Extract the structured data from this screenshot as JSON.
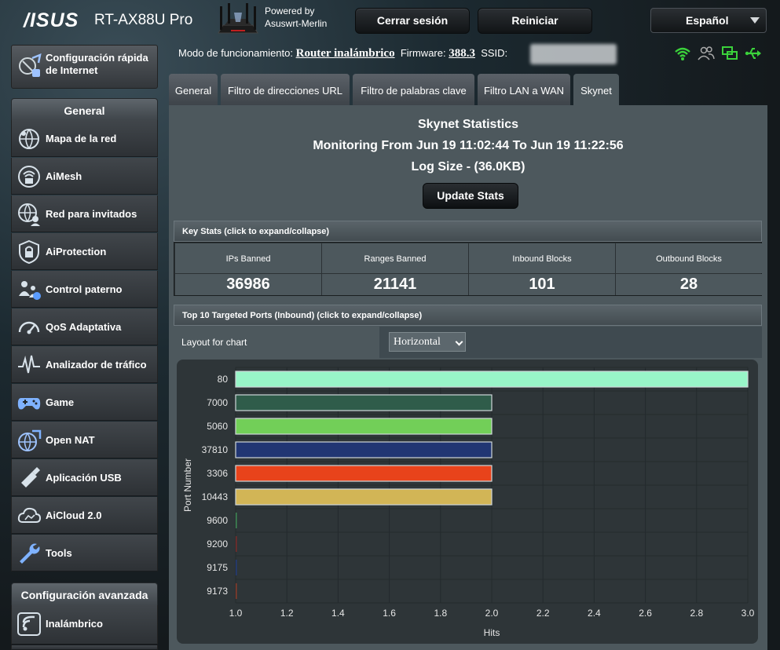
{
  "header": {
    "brand": "/ISUS",
    "model": "RT-AX88U Pro",
    "powered_line1": "Powered by",
    "powered_line2": "Asuswrt-Merlin",
    "logout_label": "Cerrar sesión",
    "reboot_label": "Reiniciar",
    "language": "Español"
  },
  "sidebar": {
    "quick_setup": "Configuración rápida de Internet",
    "general_title": "General",
    "items": [
      {
        "label": "Mapa de la red",
        "icon": "network-map-icon"
      },
      {
        "label": "AiMesh",
        "icon": "aimesh-icon"
      },
      {
        "label": "Red para invitados",
        "icon": "guest-network-icon"
      },
      {
        "label": "AiProtection",
        "icon": "shield-lock-icon"
      },
      {
        "label": "Control paterno",
        "icon": "parental-control-icon"
      },
      {
        "label": "QoS Adaptativa",
        "icon": "speedometer-icon"
      },
      {
        "label": "Analizador de tráfico",
        "icon": "traffic-analyzer-icon"
      },
      {
        "label": "Game",
        "icon": "gamepad-icon"
      },
      {
        "label": "Open NAT",
        "icon": "open-nat-icon"
      },
      {
        "label": "Aplicación USB",
        "icon": "usb-app-icon"
      },
      {
        "label": "AiCloud 2.0",
        "icon": "cloud-icon"
      },
      {
        "label": "Tools",
        "icon": "wrench-icon"
      }
    ],
    "advanced_title": "Configuración avanzada",
    "advanced_items": [
      {
        "label": "Inalámbrico",
        "icon": "wireless-icon"
      }
    ]
  },
  "status": {
    "mode_label": "Modo de funcionamiento:",
    "mode_value": "Router inalámbrico",
    "firmware_label": "Firmware:",
    "firmware_value": "388.3",
    "ssid_label": "SSID:"
  },
  "tabs": [
    "General",
    "Filtro de direcciones URL",
    "Filtro de palabras clave",
    "Filtro LAN a WAN",
    "Skynet"
  ],
  "skynet": {
    "title": "Skynet Statistics",
    "monitoring": "Monitoring From Jun 19 11:02:44 To Jun 19 11:22:56",
    "log_size": "Log Size - (36.0KB)",
    "update_button": "Update Stats",
    "key_stats_header": "Key Stats (click to expand/collapse)",
    "stats": [
      {
        "label": "IPs Banned",
        "value": "36986"
      },
      {
        "label": "Ranges Banned",
        "value": "21141"
      },
      {
        "label": "Inbound Blocks",
        "value": "101"
      },
      {
        "label": "Outbound Blocks",
        "value": "28"
      }
    ],
    "ports_header": "Top 10 Targeted Ports (Inbound) (click to expand/collapse)",
    "layout_label": "Layout for chart",
    "layout_value": "Horizontal"
  },
  "colors": {
    "bar_80": "#98f5c8",
    "bar_7000": "#2f5c4a",
    "bar_5060": "#72cf58",
    "bar_37810": "#213673",
    "bar_3306": "#e8431b",
    "bar_10443": "#d2b556"
  },
  "chart_data": {
    "type": "bar",
    "orientation": "horizontal",
    "categories": [
      "80",
      "7000",
      "5060",
      "37810",
      "3306",
      "10443",
      "9600",
      "9200",
      "9175",
      "9173"
    ],
    "values": [
      3,
      2,
      2,
      2,
      2,
      2,
      1,
      1,
      1,
      1
    ],
    "colors": [
      "#98f5c8",
      "#2f5c4a",
      "#72cf58",
      "#213673",
      "#e8431b",
      "#d2b556",
      "#3f8a55",
      "#7a2a2a",
      "#223a7a",
      "#8a3a2a"
    ],
    "xlabel": "Hits",
    "ylabel": "Port Number",
    "xlim": [
      1.0,
      3.0
    ],
    "xticks": [
      "1.0",
      "1.2",
      "1.4",
      "1.6",
      "1.8",
      "2.0",
      "2.2",
      "2.4",
      "2.6",
      "2.8",
      "3.0"
    ],
    "grid": true
  }
}
